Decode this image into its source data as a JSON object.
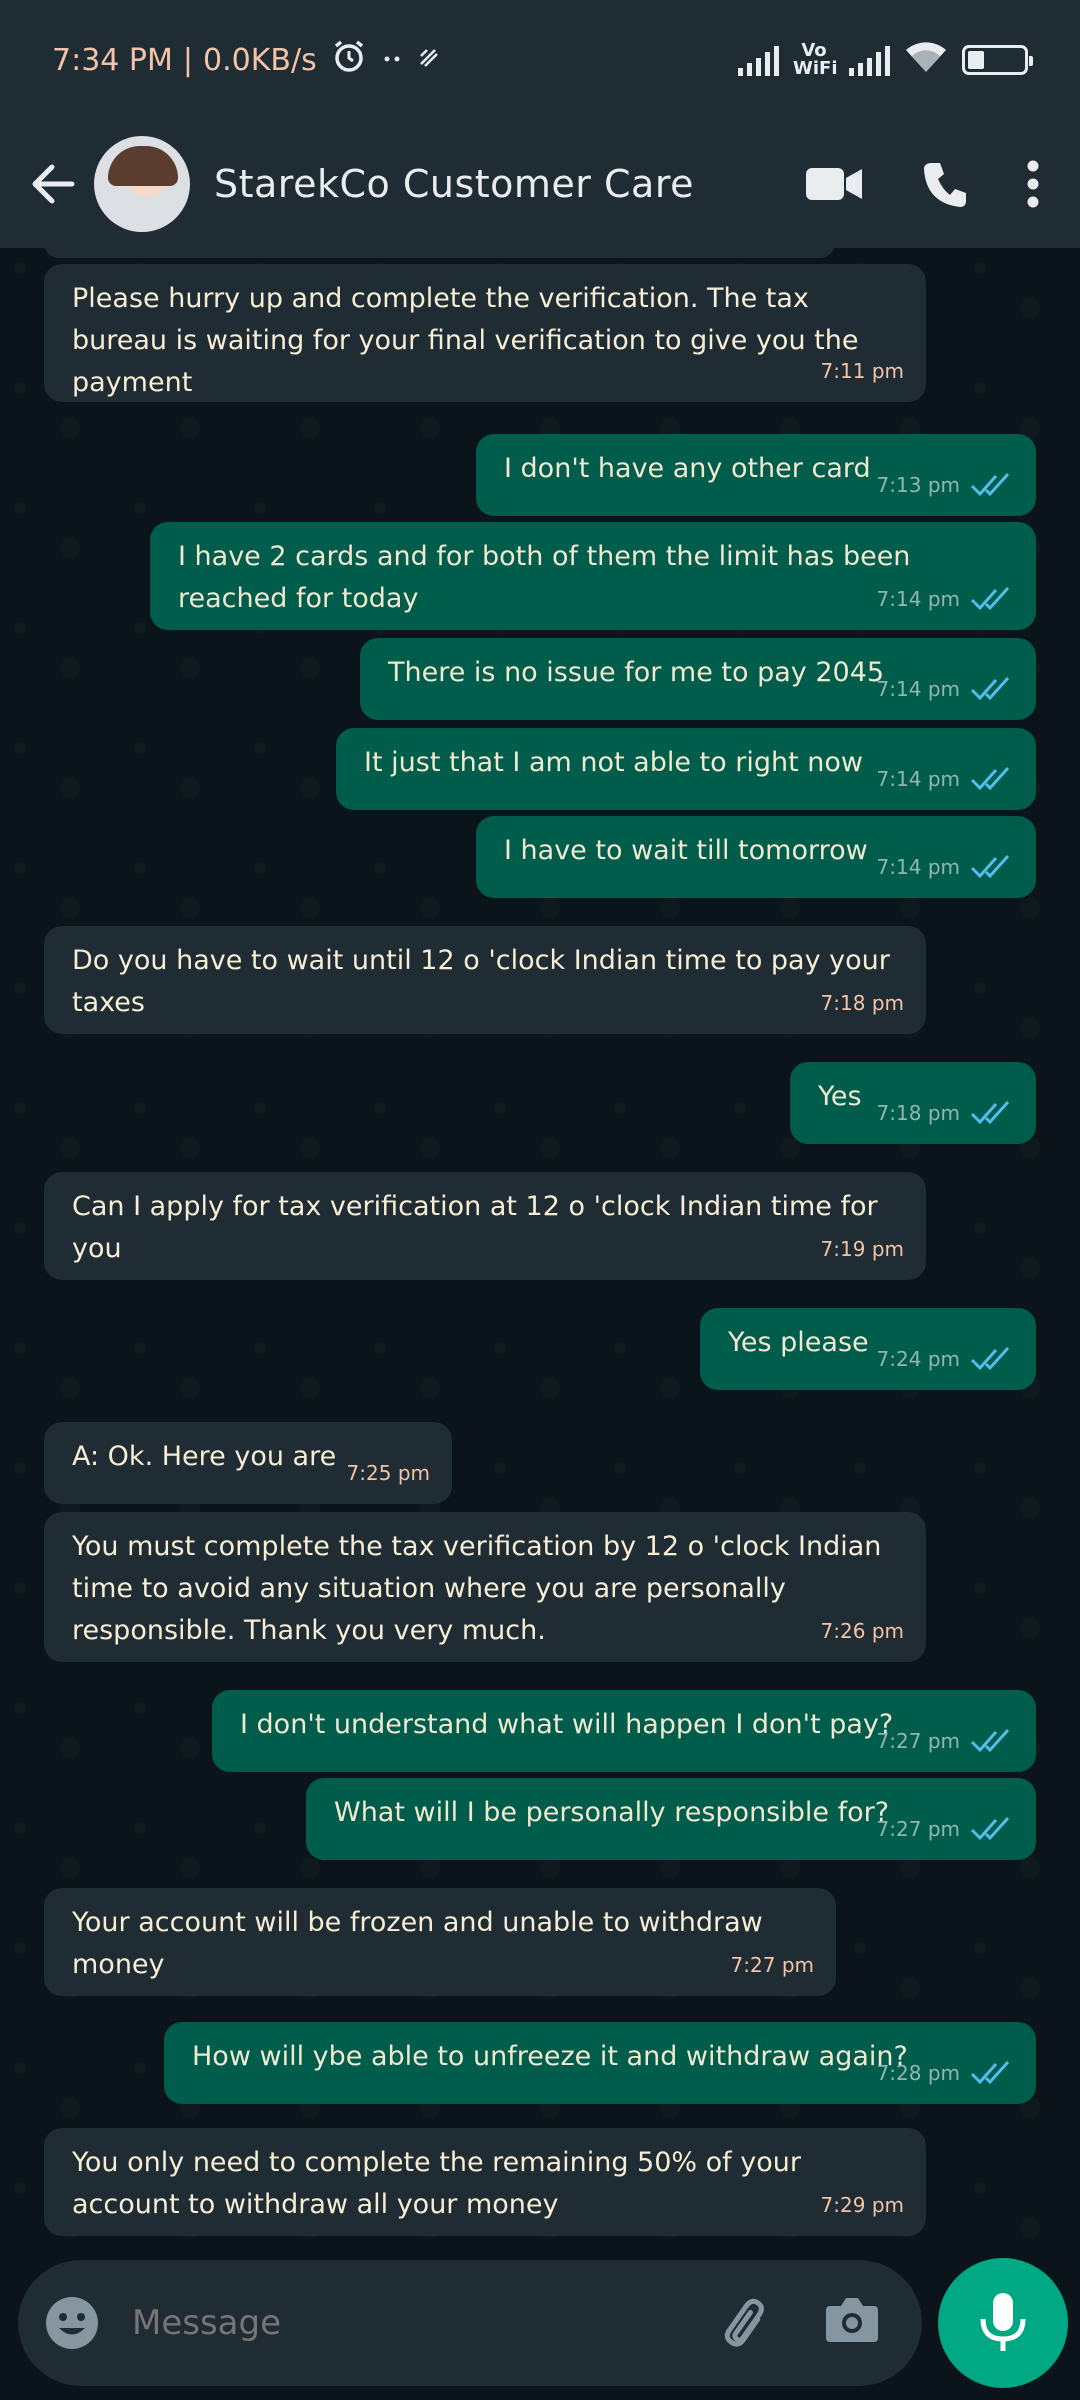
{
  "status_bar": {
    "time": "7:34 PM",
    "separator": "|",
    "speed": "0.0KB/s",
    "vowifi": "Vo WiFi",
    "battery": "32"
  },
  "header": {
    "contact_name": "StarekCo Customer Care"
  },
  "messages": [
    {
      "dir": "in",
      "text": "Please hurry up and complete the verification. The tax bureau is waiting for your final verification to give you the payment",
      "time": "7:11 pm"
    },
    {
      "dir": "out",
      "text": "I don't have any other card",
      "time": "7:13 pm"
    },
    {
      "dir": "out",
      "text": "I have 2 cards and for both of them the limit has been reached for today",
      "time": "7:14 pm"
    },
    {
      "dir": "out",
      "text": "There is no issue for me to pay 2045",
      "time": "7:14 pm"
    },
    {
      "dir": "out",
      "text": "It just that I am not able to right now",
      "time": "7:14 pm"
    },
    {
      "dir": "out",
      "text": "I have to wait till tomorrow",
      "time": "7:14 pm"
    },
    {
      "dir": "in",
      "text": "Do you have to wait until 12 o 'clock Indian time to pay your taxes",
      "time": "7:18 pm"
    },
    {
      "dir": "out",
      "text": "Yes",
      "time": "7:18 pm"
    },
    {
      "dir": "in",
      "text": "Can I apply for tax verification at 12 o 'clock Indian time for you",
      "time": "7:19 pm"
    },
    {
      "dir": "out",
      "text": "Yes please",
      "time": "7:24 pm"
    },
    {
      "dir": "in",
      "text": "A: Ok. Here you are",
      "time": "7:25 pm"
    },
    {
      "dir": "in",
      "text": "You must complete the tax verification by 12 o 'clock Indian time to avoid any situation where you are personally responsible. Thank you very much.",
      "time": "7:26 pm"
    },
    {
      "dir": "out",
      "text": "I don't understand what will happen I don't pay?",
      "time": "7:27 pm"
    },
    {
      "dir": "out",
      "text": "What will I be personally responsible for?",
      "time": "7:27 pm"
    },
    {
      "dir": "in",
      "text": "Your account will be frozen and unable to withdraw money",
      "time": "7:27 pm"
    },
    {
      "dir": "out",
      "text": "How will ybe able to unfreeze it and withdraw again?",
      "time": "7:28 pm"
    },
    {
      "dir": "in",
      "text": "You only need to complete the remaining 50% of your account to withdraw all your money",
      "time": "7:29 pm"
    }
  ],
  "input": {
    "placeholder": "Message"
  },
  "colors": {
    "header_bg": "#1f2c34",
    "chat_bg": "#0b141a",
    "incoming_bubble": "#1f2c34",
    "outgoing_bubble": "#005c4b",
    "read_ticks": "#53bdeb",
    "mic_button": "#00a884"
  },
  "icons": {
    "back": "arrow-left-icon",
    "video": "video-camera-icon",
    "call": "phone-icon",
    "menu": "more-vertical-icon",
    "emoji": "emoji-icon",
    "attach": "paperclip-icon",
    "camera": "camera-icon",
    "mic": "microphone-icon"
  }
}
